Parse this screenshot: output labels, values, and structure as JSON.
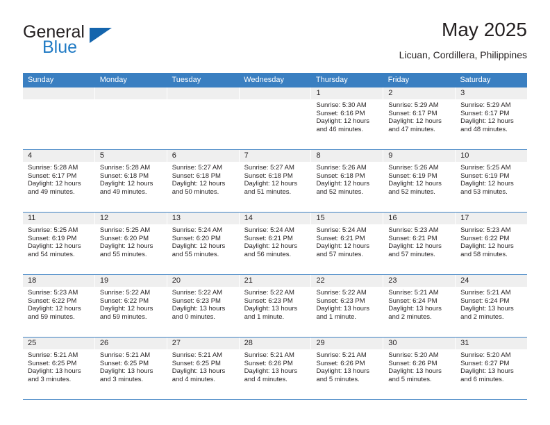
{
  "brand": {
    "name_top": "General",
    "name_bottom": "Blue",
    "accent_color": "#1f7ac4",
    "triangle_color": "#1565ad",
    "logo_icon": "general-blue-triangle-icon"
  },
  "header": {
    "title": "May 2025",
    "location": "Licuan, Cordillera, Philippines"
  },
  "calendar": {
    "header_bg": "#3a7fc1",
    "day_band_bg": "#efefef",
    "weekdays": [
      "Sunday",
      "Monday",
      "Tuesday",
      "Wednesday",
      "Thursday",
      "Friday",
      "Saturday"
    ],
    "weeks": [
      [
        {
          "day": "",
          "sunrise": "",
          "sunset": "",
          "daylight": "",
          "daylight2": ""
        },
        {
          "day": "",
          "sunrise": "",
          "sunset": "",
          "daylight": "",
          "daylight2": ""
        },
        {
          "day": "",
          "sunrise": "",
          "sunset": "",
          "daylight": "",
          "daylight2": ""
        },
        {
          "day": "",
          "sunrise": "",
          "sunset": "",
          "daylight": "",
          "daylight2": ""
        },
        {
          "day": "1",
          "sunrise": "Sunrise: 5:30 AM",
          "sunset": "Sunset: 6:16 PM",
          "daylight": "Daylight: 12 hours",
          "daylight2": "and 46 minutes."
        },
        {
          "day": "2",
          "sunrise": "Sunrise: 5:29 AM",
          "sunset": "Sunset: 6:17 PM",
          "daylight": "Daylight: 12 hours",
          "daylight2": "and 47 minutes."
        },
        {
          "day": "3",
          "sunrise": "Sunrise: 5:29 AM",
          "sunset": "Sunset: 6:17 PM",
          "daylight": "Daylight: 12 hours",
          "daylight2": "and 48 minutes."
        }
      ],
      [
        {
          "day": "4",
          "sunrise": "Sunrise: 5:28 AM",
          "sunset": "Sunset: 6:17 PM",
          "daylight": "Daylight: 12 hours",
          "daylight2": "and 49 minutes."
        },
        {
          "day": "5",
          "sunrise": "Sunrise: 5:28 AM",
          "sunset": "Sunset: 6:18 PM",
          "daylight": "Daylight: 12 hours",
          "daylight2": "and 49 minutes."
        },
        {
          "day": "6",
          "sunrise": "Sunrise: 5:27 AM",
          "sunset": "Sunset: 6:18 PM",
          "daylight": "Daylight: 12 hours",
          "daylight2": "and 50 minutes."
        },
        {
          "day": "7",
          "sunrise": "Sunrise: 5:27 AM",
          "sunset": "Sunset: 6:18 PM",
          "daylight": "Daylight: 12 hours",
          "daylight2": "and 51 minutes."
        },
        {
          "day": "8",
          "sunrise": "Sunrise: 5:26 AM",
          "sunset": "Sunset: 6:18 PM",
          "daylight": "Daylight: 12 hours",
          "daylight2": "and 52 minutes."
        },
        {
          "day": "9",
          "sunrise": "Sunrise: 5:26 AM",
          "sunset": "Sunset: 6:19 PM",
          "daylight": "Daylight: 12 hours",
          "daylight2": "and 52 minutes."
        },
        {
          "day": "10",
          "sunrise": "Sunrise: 5:25 AM",
          "sunset": "Sunset: 6:19 PM",
          "daylight": "Daylight: 12 hours",
          "daylight2": "and 53 minutes."
        }
      ],
      [
        {
          "day": "11",
          "sunrise": "Sunrise: 5:25 AM",
          "sunset": "Sunset: 6:19 PM",
          "daylight": "Daylight: 12 hours",
          "daylight2": "and 54 minutes."
        },
        {
          "day": "12",
          "sunrise": "Sunrise: 5:25 AM",
          "sunset": "Sunset: 6:20 PM",
          "daylight": "Daylight: 12 hours",
          "daylight2": "and 55 minutes."
        },
        {
          "day": "13",
          "sunrise": "Sunrise: 5:24 AM",
          "sunset": "Sunset: 6:20 PM",
          "daylight": "Daylight: 12 hours",
          "daylight2": "and 55 minutes."
        },
        {
          "day": "14",
          "sunrise": "Sunrise: 5:24 AM",
          "sunset": "Sunset: 6:21 PM",
          "daylight": "Daylight: 12 hours",
          "daylight2": "and 56 minutes."
        },
        {
          "day": "15",
          "sunrise": "Sunrise: 5:24 AM",
          "sunset": "Sunset: 6:21 PM",
          "daylight": "Daylight: 12 hours",
          "daylight2": "and 57 minutes."
        },
        {
          "day": "16",
          "sunrise": "Sunrise: 5:23 AM",
          "sunset": "Sunset: 6:21 PM",
          "daylight": "Daylight: 12 hours",
          "daylight2": "and 57 minutes."
        },
        {
          "day": "17",
          "sunrise": "Sunrise: 5:23 AM",
          "sunset": "Sunset: 6:22 PM",
          "daylight": "Daylight: 12 hours",
          "daylight2": "and 58 minutes."
        }
      ],
      [
        {
          "day": "18",
          "sunrise": "Sunrise: 5:23 AM",
          "sunset": "Sunset: 6:22 PM",
          "daylight": "Daylight: 12 hours",
          "daylight2": "and 59 minutes."
        },
        {
          "day": "19",
          "sunrise": "Sunrise: 5:22 AM",
          "sunset": "Sunset: 6:22 PM",
          "daylight": "Daylight: 12 hours",
          "daylight2": "and 59 minutes."
        },
        {
          "day": "20",
          "sunrise": "Sunrise: 5:22 AM",
          "sunset": "Sunset: 6:23 PM",
          "daylight": "Daylight: 13 hours",
          "daylight2": "and 0 minutes."
        },
        {
          "day": "21",
          "sunrise": "Sunrise: 5:22 AM",
          "sunset": "Sunset: 6:23 PM",
          "daylight": "Daylight: 13 hours",
          "daylight2": "and 1 minute."
        },
        {
          "day": "22",
          "sunrise": "Sunrise: 5:22 AM",
          "sunset": "Sunset: 6:23 PM",
          "daylight": "Daylight: 13 hours",
          "daylight2": "and 1 minute."
        },
        {
          "day": "23",
          "sunrise": "Sunrise: 5:21 AM",
          "sunset": "Sunset: 6:24 PM",
          "daylight": "Daylight: 13 hours",
          "daylight2": "and 2 minutes."
        },
        {
          "day": "24",
          "sunrise": "Sunrise: 5:21 AM",
          "sunset": "Sunset: 6:24 PM",
          "daylight": "Daylight: 13 hours",
          "daylight2": "and 2 minutes."
        }
      ],
      [
        {
          "day": "25",
          "sunrise": "Sunrise: 5:21 AM",
          "sunset": "Sunset: 6:25 PM",
          "daylight": "Daylight: 13 hours",
          "daylight2": "and 3 minutes."
        },
        {
          "day": "26",
          "sunrise": "Sunrise: 5:21 AM",
          "sunset": "Sunset: 6:25 PM",
          "daylight": "Daylight: 13 hours",
          "daylight2": "and 3 minutes."
        },
        {
          "day": "27",
          "sunrise": "Sunrise: 5:21 AM",
          "sunset": "Sunset: 6:25 PM",
          "daylight": "Daylight: 13 hours",
          "daylight2": "and 4 minutes."
        },
        {
          "day": "28",
          "sunrise": "Sunrise: 5:21 AM",
          "sunset": "Sunset: 6:26 PM",
          "daylight": "Daylight: 13 hours",
          "daylight2": "and 4 minutes."
        },
        {
          "day": "29",
          "sunrise": "Sunrise: 5:21 AM",
          "sunset": "Sunset: 6:26 PM",
          "daylight": "Daylight: 13 hours",
          "daylight2": "and 5 minutes."
        },
        {
          "day": "30",
          "sunrise": "Sunrise: 5:20 AM",
          "sunset": "Sunset: 6:26 PM",
          "daylight": "Daylight: 13 hours",
          "daylight2": "and 5 minutes."
        },
        {
          "day": "31",
          "sunrise": "Sunrise: 5:20 AM",
          "sunset": "Sunset: 6:27 PM",
          "daylight": "Daylight: 13 hours",
          "daylight2": "and 6 minutes."
        }
      ]
    ]
  }
}
